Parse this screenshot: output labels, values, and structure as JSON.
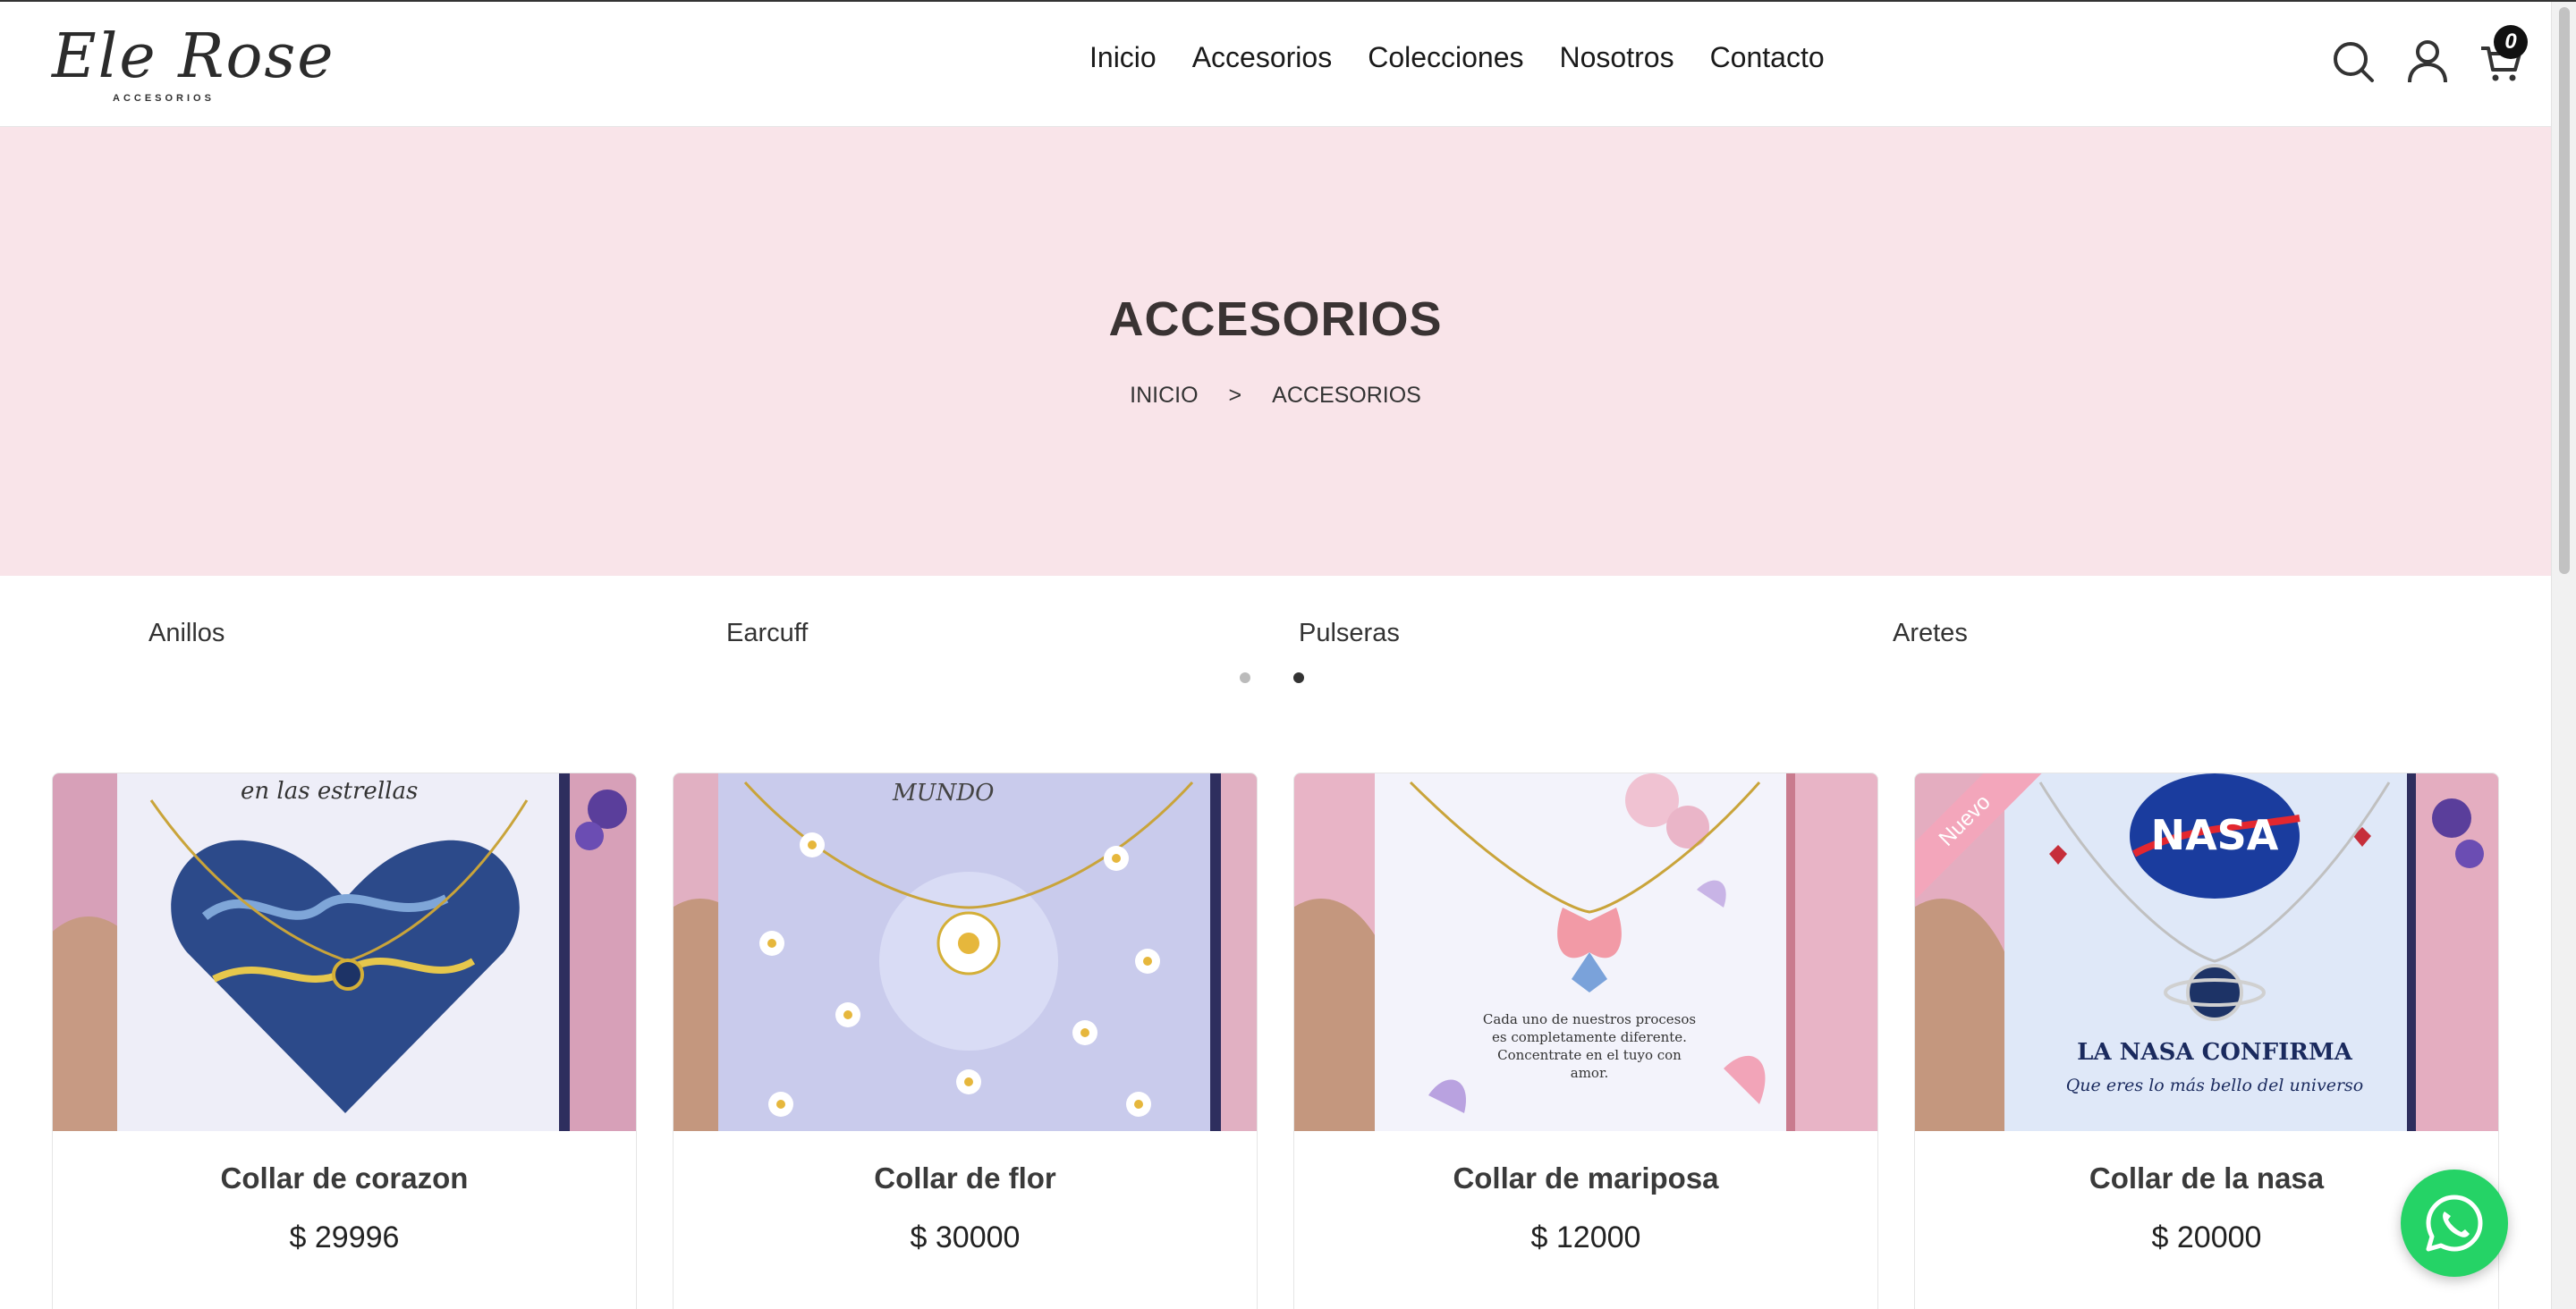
{
  "brand": {
    "logo_text": "Ele Rose",
    "logo_subtitle": "ACCESORIOS"
  },
  "nav": {
    "items": [
      "Inicio",
      "Accesorios",
      "Colecciones",
      "Nosotros",
      "Contacto"
    ]
  },
  "header_icons": {
    "search": "search-icon",
    "account": "user-icon",
    "cart": "cart-icon",
    "cart_count": "0"
  },
  "hero": {
    "title": "ACCESORIOS",
    "breadcrumb": [
      "INICIO",
      "ACCESORIOS"
    ],
    "separator": ">",
    "background": "#f9e4e9"
  },
  "categories": [
    "Anillos",
    "Earcuff",
    "Pulseras",
    "Aretes"
  ],
  "carousel": {
    "pages": 2,
    "active": 2
  },
  "products": [
    {
      "name": "Collar de corazon",
      "price": "$ 29996",
      "card_text": "en las estrellas",
      "badge": ""
    },
    {
      "name": "Collar de flor",
      "price": "$ 30000",
      "card_text": "MUNDO",
      "badge": ""
    },
    {
      "name": "Collar de mariposa",
      "price": "$ 12000",
      "card_text": "Cada uno de nuestros procesos es completamente diferente. Concentrate en el tuyo con amor.",
      "badge": ""
    },
    {
      "name": "Collar de la nasa",
      "price": "$ 20000",
      "card_text": "LA NASA CONFIRMA",
      "card_subtext": "Que eres lo más bello del universo",
      "card_logo": "NASA",
      "badge": "Nuevo"
    }
  ],
  "floating": {
    "whatsapp": "whatsapp-icon",
    "color": "#25d366"
  }
}
